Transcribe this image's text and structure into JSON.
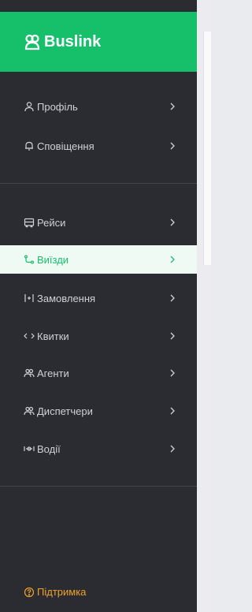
{
  "brand": {
    "name": "Buslink",
    "logo_icon": "bus-logo-icon"
  },
  "colors": {
    "sidebar": "#2b2c31",
    "brand": "#16c06b",
    "active_bg": "#eefaf3",
    "active_text": "#16c06b",
    "support": "#f0a12a"
  },
  "menu": {
    "profile": {
      "label": "Профіль",
      "icon": "user-icon"
    },
    "notifications": {
      "label": "Сповіщення",
      "icon": "bell-icon"
    },
    "trips": {
      "label": "Рейси",
      "icon": "bus-icon"
    },
    "departures": {
      "label": "Виїзди",
      "icon": "route-icon",
      "active": true
    },
    "orders": {
      "label": "Замовлення",
      "icon": "orders-icon"
    },
    "tickets": {
      "label": "Квитки",
      "icon": "ticket-icon"
    },
    "agents": {
      "label": "Агенти",
      "icon": "agents-icon"
    },
    "dispatchers": {
      "label": "Диспетчери",
      "icon": "dispatchers-icon"
    },
    "drivers": {
      "label": "Водії",
      "icon": "drivers-icon"
    }
  },
  "support": {
    "label": "Підтримка",
    "icon": "help-icon"
  }
}
